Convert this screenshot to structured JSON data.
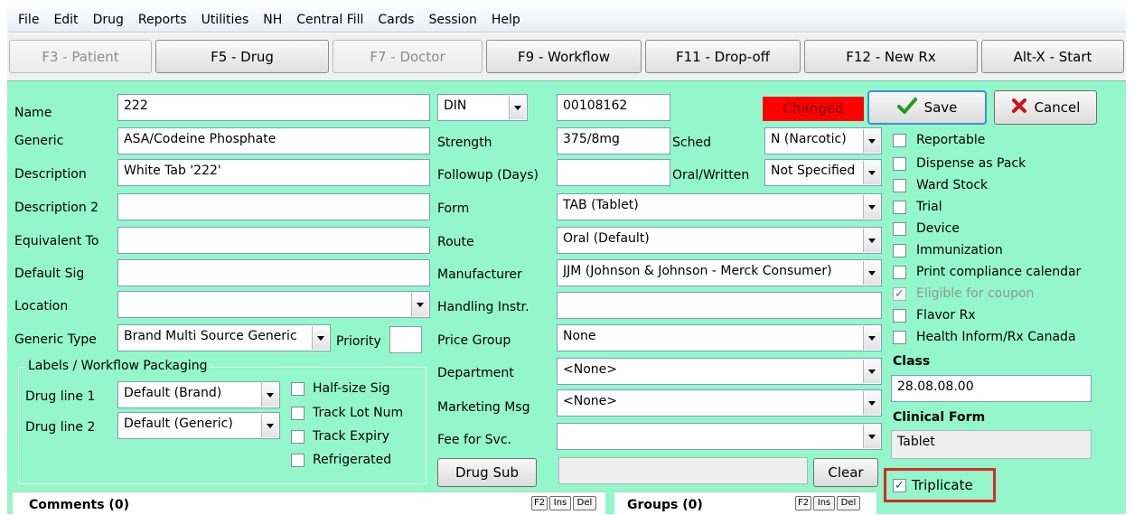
{
  "menu": [
    "File",
    "Edit",
    "Drug",
    "Reports",
    "Utilities",
    "NH",
    "Central Fill",
    "Cards",
    "Session",
    "Help"
  ],
  "toolbar": {
    "patient": "F3 - Patient",
    "drug": "F5 - Drug",
    "doctor": "F7 - Doctor",
    "workflow": "F9 - Workflow",
    "dropoff": "F11 - Drop-off",
    "newrx": "F12 - New Rx",
    "start": "Alt-X - Start"
  },
  "form": {
    "name_label": "Name",
    "name": "222",
    "generic_label": "Generic",
    "generic": "ASA/Codeine Phosphate",
    "description_label": "Description",
    "description": "White Tab '222'",
    "description2_label": "Description 2",
    "description2": "",
    "equivalent_label": "Equivalent To",
    "equivalent": "",
    "default_sig_label": "Default Sig",
    "default_sig": "",
    "location_label": "Location",
    "location": "",
    "generic_type_label": "Generic Type",
    "generic_type": "Brand Multi Source Generic",
    "priority_label": "Priority",
    "priority": "",
    "din_select": "DIN",
    "din": "00108162",
    "changed_label": "Changed",
    "strength_label": "Strength",
    "strength": "375/8mg",
    "sched_label": "Sched",
    "sched": "N (Narcotic)",
    "followup_label": "Followup (Days)",
    "followup": "",
    "oral_written_label": "Oral/Written",
    "oral_written": "Not Specified",
    "form_label": "Form",
    "form": "TAB (Tablet)",
    "route_label": "Route",
    "route": "Oral (Default)",
    "manufacturer_label": "Manufacturer",
    "manufacturer": "JJM (Johnson & Johnson - Merck Consumer)",
    "handling_label": "Handling Instr.",
    "handling": "",
    "price_group_label": "Price Group",
    "price_group": "None",
    "department_label": "Department",
    "department": "<None>",
    "marketing_label": "Marketing Msg",
    "marketing": "<None>",
    "fee_label": "Fee for Svc.",
    "fee": "",
    "drug_sub_button": "Drug Sub",
    "drug_sub_value": "",
    "clear_button": "Clear",
    "save_button": "Save",
    "cancel_button": "Cancel"
  },
  "labels_group": {
    "title": "Labels / Workflow Packaging",
    "drug_line1_label": "Drug line 1",
    "drug_line1": "Default (Brand)",
    "drug_line2_label": "Drug line 2",
    "drug_line2": "Default (Generic)",
    "half_size_sig": "Half-size Sig",
    "track_lot": "Track Lot Num",
    "track_expiry": "Track Expiry",
    "refrigerated": "Refrigerated"
  },
  "options": {
    "reportable": "Reportable",
    "dispense_pack": "Dispense as Pack",
    "ward_stock": "Ward Stock",
    "trial": "Trial",
    "device": "Device",
    "immunization": "Immunization",
    "print_calendar": "Print compliance calendar",
    "eligible_coupon": "Eligible for coupon",
    "flavor_rx": "Flavor Rx",
    "health_inform": "Health Inform/Rx Canada",
    "class_label": "Class",
    "class": "28.08.08.00",
    "clinical_form_label": "Clinical Form",
    "clinical_form": "Tablet",
    "triplicate": "Triplicate"
  },
  "bottom": {
    "comments": "Comments (0)",
    "groups": "Groups (0)",
    "f2": "F2",
    "ins": "Ins",
    "del": "Del"
  },
  "colors": {
    "panel": "#94f7cb",
    "changed_bg": "#ff0000",
    "changed_fg": "#7a0000",
    "highlight_border": "#d62b2b",
    "save_check": "#1f9a1f",
    "cancel_x": "#d11414"
  }
}
